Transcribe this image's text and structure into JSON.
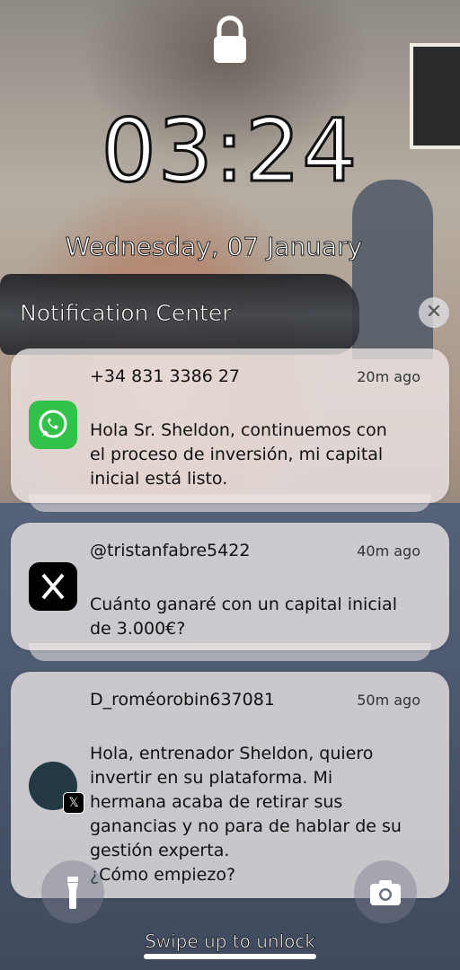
{
  "lockscreen": {
    "time": "03:24",
    "date": "Wednesday, 07 January",
    "notification_center_title": "Notification Center",
    "close_icon": "close-icon",
    "swipe_hint": "Swipe up to unlock"
  },
  "notifications": [
    {
      "app_icon": "whatsapp-icon",
      "sender": "+34 831 3386 27",
      "time_ago": "20m ago",
      "message_lines": [
        "Hola Sr. Sheldon, continuemos con",
        "el proceso de inversión, mi capital",
        "inicial está listo."
      ]
    },
    {
      "app_icon": "x-icon",
      "sender": "@tristanfabre5422",
      "time_ago": "40m ago",
      "message_lines": [
        "Cuánto ganaré con un capital inicial",
        "de 3.000€?"
      ]
    },
    {
      "app_icon": "avatar",
      "badge_icon": "x-badge-icon",
      "sender": "D_roméorobin637081",
      "time_ago": "50m ago",
      "message_lines": [
        "Hola, entrenador Sheldon, quiero",
        "invertir en su plataforma. Mi",
        "hermana acaba de retirar sus",
        "ganancias y no para de hablar de su",
        "gestión experta.",
        "¿Cómo empiezo?"
      ]
    }
  ],
  "quick_actions": {
    "flashlight_icon": "flashlight-icon",
    "camera_icon": "camera-icon"
  },
  "colors": {
    "whatsapp_green": "#32c24a",
    "x_black": "#000000",
    "card_background": "#eee8e8"
  }
}
